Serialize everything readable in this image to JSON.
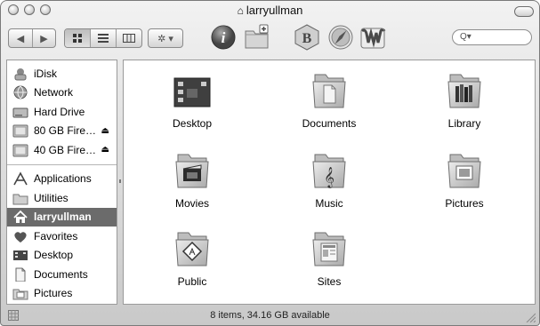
{
  "window": {
    "title": "larryullman",
    "status": "8 items, 34.16 GB available"
  },
  "toolbar": {
    "back_label": "◀",
    "forward_label": "▶",
    "search_placeholder": "Q▾"
  },
  "sidebar": {
    "devices": [
      {
        "label": "iDisk",
        "icon": "idisk-icon",
        "eject": ""
      },
      {
        "label": "Network",
        "icon": "network-icon",
        "eject": ""
      },
      {
        "label": "Hard Drive",
        "icon": "hard-drive-icon",
        "eject": ""
      },
      {
        "label": "80 GB Fire…",
        "icon": "firewire-drive-icon",
        "eject": "⏏"
      },
      {
        "label": "40 GB Fire…",
        "icon": "firewire-drive-icon",
        "eject": "⏏"
      }
    ],
    "places": [
      {
        "label": "Applications",
        "icon": "applications-icon"
      },
      {
        "label": "Utilities",
        "icon": "folder-icon"
      },
      {
        "label": "larryullman",
        "icon": "home-icon",
        "selected": true
      },
      {
        "label": "Favorites",
        "icon": "heart-icon"
      },
      {
        "label": "Desktop",
        "icon": "desktop-icon"
      },
      {
        "label": "Documents",
        "icon": "documents-icon"
      },
      {
        "label": "Pictures",
        "icon": "pictures-icon"
      }
    ]
  },
  "content": {
    "items": [
      {
        "label": "Desktop",
        "icon": "desktop-folder-icon"
      },
      {
        "label": "Documents",
        "icon": "documents-folder-icon"
      },
      {
        "label": "Library",
        "icon": "library-folder-icon"
      },
      {
        "label": "Movies",
        "icon": "movies-folder-icon"
      },
      {
        "label": "Music",
        "icon": "music-folder-icon"
      },
      {
        "label": "Pictures",
        "icon": "pictures-folder-icon"
      },
      {
        "label": "Public",
        "icon": "public-folder-icon"
      },
      {
        "label": "Sites",
        "icon": "sites-folder-icon"
      }
    ]
  }
}
